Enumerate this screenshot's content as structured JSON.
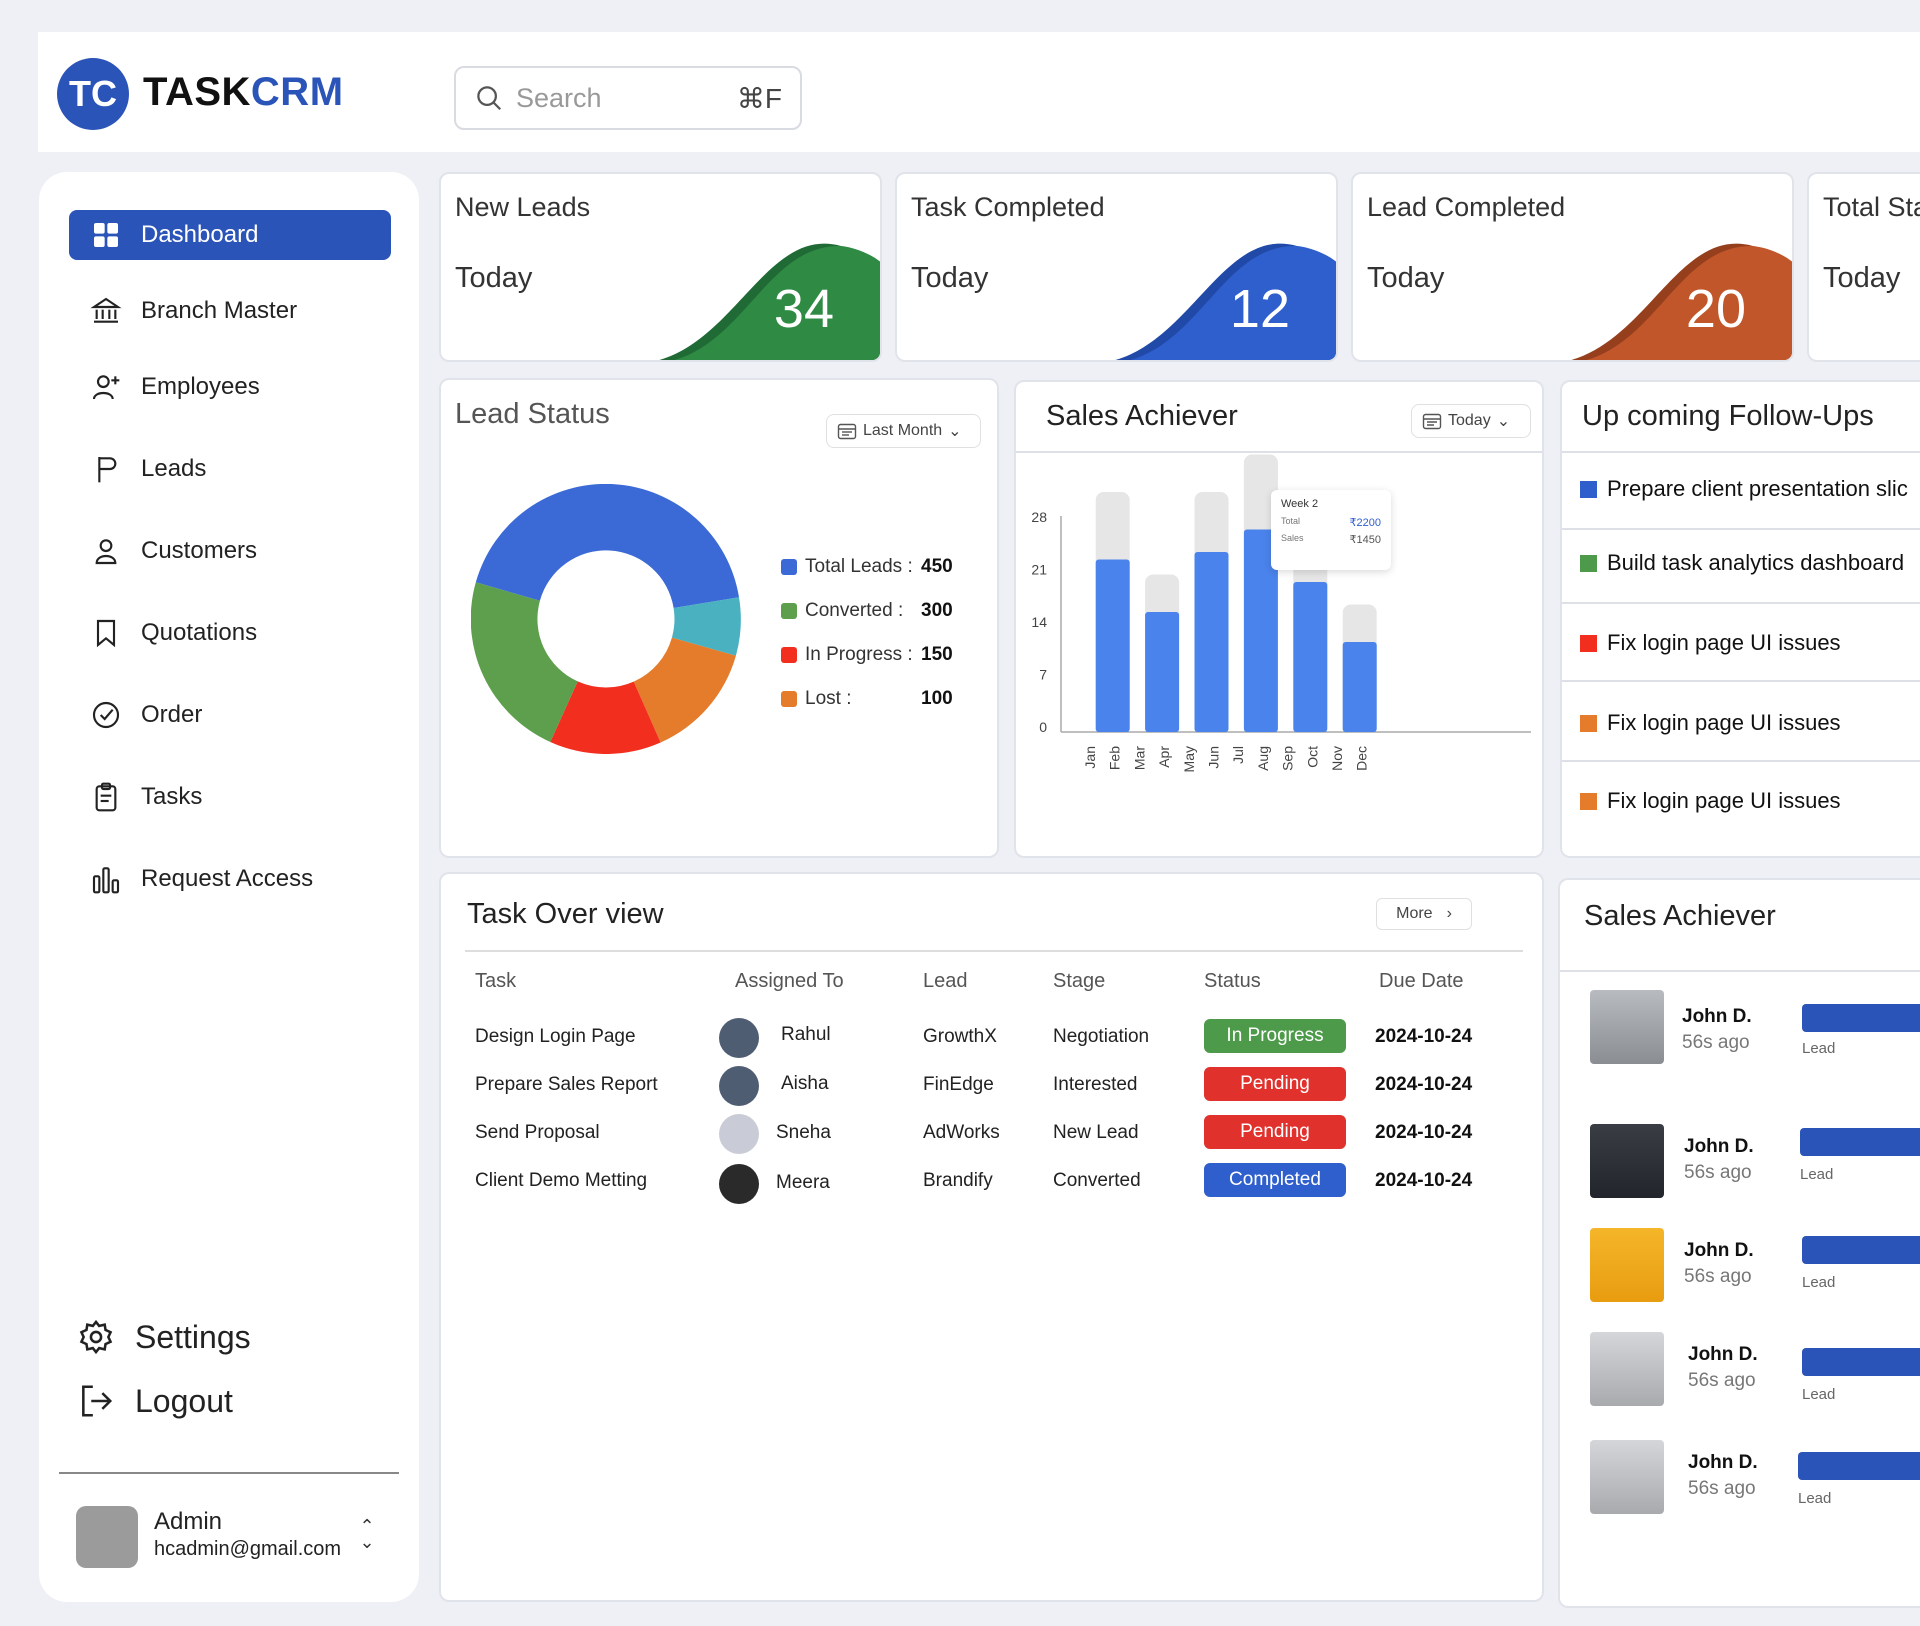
{
  "brand": {
    "logo_initials": "TC",
    "name_part1": "TASK",
    "name_part2": "CRM",
    "color": "#2b54b8"
  },
  "search": {
    "placeholder": "Search",
    "shortcut": "⌘F"
  },
  "sidebar": {
    "items": [
      {
        "label": "Dashboard",
        "icon": "grid-icon",
        "active": true
      },
      {
        "label": "Branch Master",
        "icon": "bank-icon"
      },
      {
        "label": "Employees",
        "icon": "user-add-icon"
      },
      {
        "label": "Leads",
        "icon": "flag-icon"
      },
      {
        "label": "Customers",
        "icon": "person-icon"
      },
      {
        "label": "Quotations",
        "icon": "bookmark-icon"
      },
      {
        "label": "Order",
        "icon": "check-circle-icon"
      },
      {
        "label": "Tasks",
        "icon": "clipboard-icon"
      },
      {
        "label": "Request Access",
        "icon": "bar-chart-icon"
      }
    ],
    "settings": "Settings",
    "logout": "Logout",
    "admin": {
      "name": "Admin",
      "email": "hcadmin@gmail.com"
    }
  },
  "stats": [
    {
      "title": "New Leads",
      "period": "Today",
      "value": "34",
      "color": "#2f8a44"
    },
    {
      "title": "Task Completed",
      "period": "Today",
      "value": "12",
      "color": "#2f5fcc"
    },
    {
      "title": "Lead Completed",
      "period": "Today",
      "value": "20",
      "color": "#c0562a"
    },
    {
      "title": "Total Sta",
      "period": "Today",
      "value": "",
      "color": "#ffffff"
    }
  ],
  "lead_status": {
    "title": "Lead Status",
    "filter": "Last Month",
    "legend": [
      {
        "label": "Total Leads :",
        "value": "450",
        "color": "#3b6ad6"
      },
      {
        "label": "Converted :",
        "value": "300",
        "color": "#5d9f4c"
      },
      {
        "label": "In Progress :",
        "value": "150",
        "color": "#f22e1e"
      },
      {
        "label": "Lost :",
        "value": "100",
        "color": "#e57c2b"
      }
    ]
  },
  "sales_achiever_chart": {
    "title": "Sales Achiever",
    "filter": "Today",
    "tooltip": {
      "week": "Week 2",
      "total_label": "Total",
      "total_value": "₹2200",
      "sales_label": "Sales",
      "sales_value": "₹1450"
    }
  },
  "chart_data": {
    "type": "bar",
    "categories": [
      "Jan",
      "Feb",
      "Mar",
      "Apr",
      "May",
      "Jun",
      "Jul",
      "Aug",
      "Sep",
      "Oct",
      "Nov",
      "Dec"
    ],
    "bar_positions": [
      "Feb",
      "Apr",
      "Jun",
      "Aug",
      "Oct",
      "Dec"
    ],
    "series": [
      {
        "name": "Total",
        "values": [
          32,
          21,
          32,
          37,
          27,
          17
        ]
      },
      {
        "name": "Sales",
        "values": [
          23,
          16,
          24,
          27,
          20,
          12
        ]
      }
    ],
    "yticks": [
      0,
      7,
      14,
      21,
      28
    ],
    "ylim": [
      0,
      40
    ]
  },
  "followups": {
    "title": "Up coming Follow-Ups",
    "items": [
      {
        "label": "Prepare client presentation slic",
        "color": "#2f5fcc"
      },
      {
        "label": "Build task analytics dashboard",
        "color": "#4d9a4a"
      },
      {
        "label": "Fix login page UI issues",
        "color": "#f22e1e"
      },
      {
        "label": "Fix login page UI issues",
        "color": "#e57c2b"
      },
      {
        "label": "Fix login page UI issues",
        "color": "#e57c2b"
      }
    ]
  },
  "task_overview": {
    "title": "Task Over view",
    "more": "More",
    "headers": [
      "Task",
      "Assigned To",
      "Lead",
      "Stage",
      "Status",
      "Due Date"
    ],
    "rows": [
      {
        "task": "Design Login Page",
        "assigned": "Rahul",
        "lead": "GrowthX",
        "stage": "Negotiation",
        "status": "In Progress",
        "status_color": "#4d9a4a",
        "due": "2024-10-24"
      },
      {
        "task": "Prepare Sales Report",
        "assigned": "Aisha",
        "lead": "FinEdge",
        "stage": "Interested",
        "status": "Pending",
        "status_color": "#e0312d",
        "due": "2024-10-24"
      },
      {
        "task": "Send Proposal",
        "assigned": "Sneha",
        "lead": "AdWorks",
        "stage": "New Lead",
        "status": "Pending",
        "status_color": "#e0312d",
        "due": "2024-10-24"
      },
      {
        "task": "Client Demo Metting",
        "assigned": "Meera",
        "lead": "Brandify",
        "stage": "Converted",
        "status": "Completed",
        "status_color": "#2f5fcc",
        "due": "2024-10-24"
      }
    ]
  },
  "sales_achiever_list": {
    "title": "Sales Achiever",
    "items": [
      {
        "name": "John D.",
        "time": "56s ago",
        "label": "Lead"
      },
      {
        "name": "John D.",
        "time": "56s ago",
        "label": "Lead"
      },
      {
        "name": "John D.",
        "time": "56s ago",
        "label": "Lead"
      },
      {
        "name": "John D.",
        "time": "56s ago",
        "label": "Lead"
      },
      {
        "name": "John D.",
        "time": "56s ago",
        "label": "Lead"
      }
    ]
  }
}
